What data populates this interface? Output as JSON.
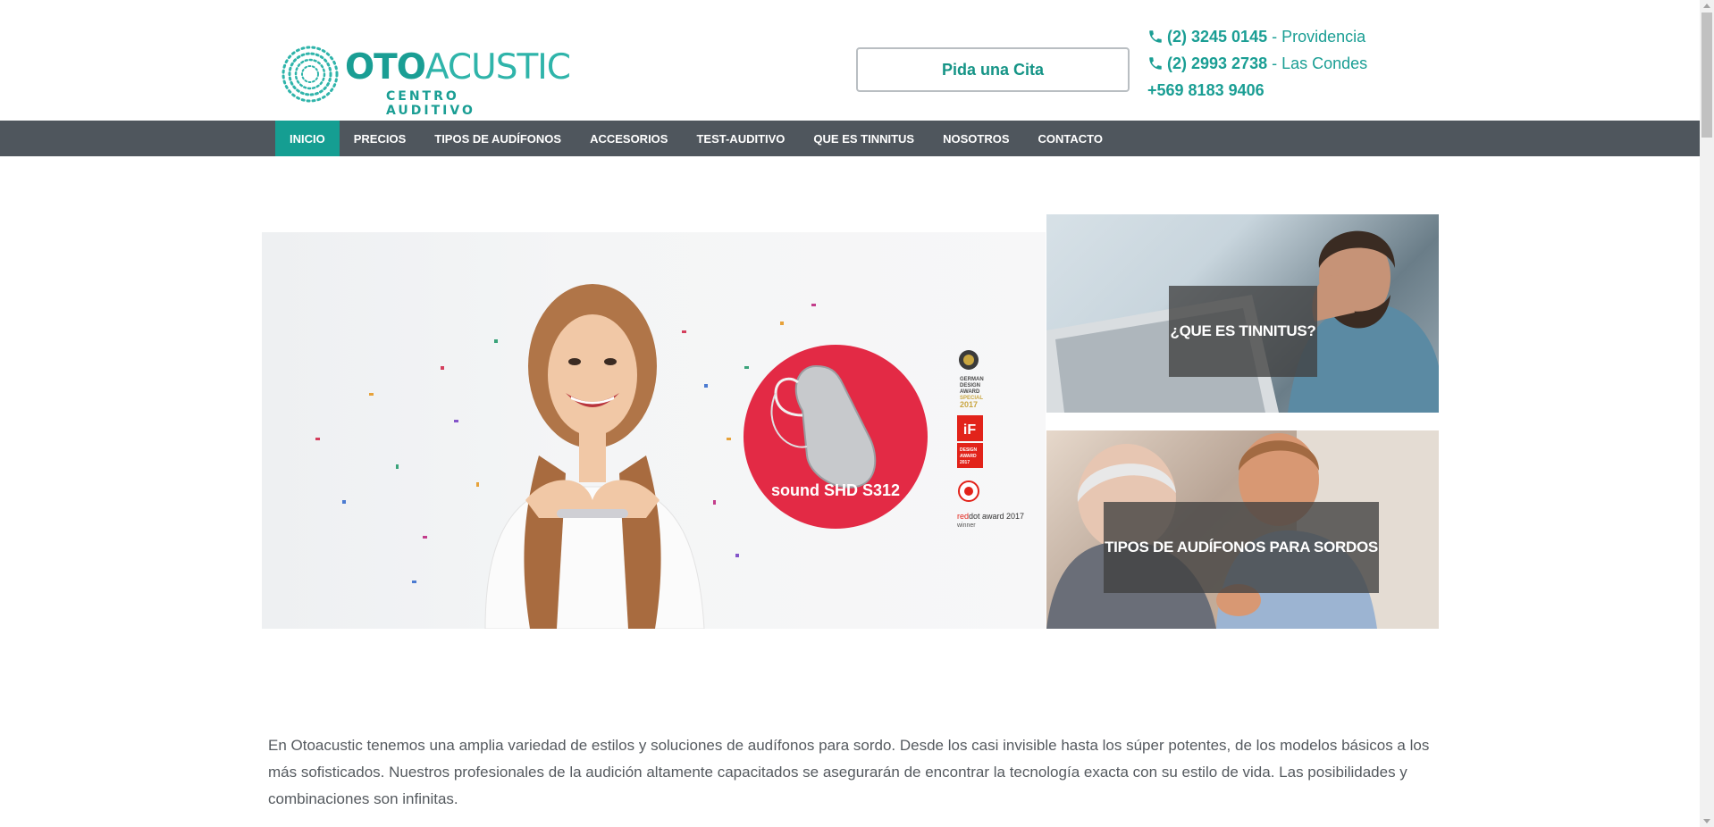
{
  "brand": {
    "name_bold": "OTO",
    "name_light": "ACUSTIC",
    "tagline": "CENTRO AUDITIVO",
    "color": "#1a9e94"
  },
  "header": {
    "cta_label": "Pida una Cita",
    "phones": [
      {
        "icon": "phone-icon",
        "number": "(2) 3245 0145",
        "separator": "-",
        "location": "Providencia"
      },
      {
        "icon": "phone-icon",
        "number": "(2) 2993 2738",
        "separator": "-",
        "location": "Las Condes"
      },
      {
        "number": "+569 8183 9406"
      }
    ]
  },
  "nav": {
    "items": [
      {
        "label": "INICIO",
        "active": true
      },
      {
        "label": "PRECIOS"
      },
      {
        "label": "TIPOS DE AUDÍFONOS"
      },
      {
        "label": "ACCESORIOS"
      },
      {
        "label": "TEST-AUDITIVO"
      },
      {
        "label": "QUE ES TINNITUS"
      },
      {
        "label": "NOSOTROS"
      },
      {
        "label": "CONTACTO"
      }
    ],
    "bg": "#4f565d",
    "active_bg": "#159e92"
  },
  "hero": {
    "product_label": "sound SHD S312",
    "badge_color": "#e32a45",
    "awards": {
      "german_design": [
        "GERMAN",
        "DESIGN",
        "AWARD",
        "SPECIAL",
        "2017"
      ],
      "if_logo": "iF",
      "if_text": [
        "DESIGN",
        "AWARD",
        "2017"
      ],
      "reddot_red": "red",
      "reddot_dark": "dot award 2017",
      "reddot_sub": "winner"
    }
  },
  "cards": [
    {
      "title": "¿QUE ES TINNITUS?"
    },
    {
      "title": "TIPOS DE AUDÍFONOS PARA SORDOS"
    }
  ],
  "content": {
    "intro": "En Otoacustic tenemos una amplia variedad de estilos y soluciones de audífonos para sordo. Desde los casi invisible hasta los súper potentes, de los modelos básicos a los más sofisticados. Nuestros profesionales de la audición altamente capacitados se asegurarán de encontrar la tecnología exacta con su estilo de vida. Las posibilidades y combinaciones son infinitas."
  }
}
